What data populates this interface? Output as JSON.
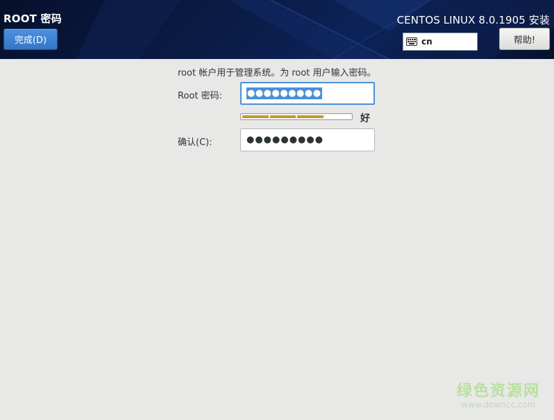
{
  "header": {
    "page_title": "ROOT 密码",
    "done_label": "完成(D)",
    "product_title": "CENTOS LINUX 8.0.1905 安装",
    "keyboard_layout": "cn",
    "help_label": "帮助!"
  },
  "form": {
    "description": "root 帐户用于管理系统。为 root 用户输入密码。",
    "root_password_label": "Root 密码:",
    "root_password_value": "●●●●●●●●●",
    "strength_label": "好",
    "strength_level": 0.75,
    "confirm_label": "确认(C):",
    "confirm_password_value": "●●●●●●●●●"
  },
  "watermark": {
    "text": "绿色资源网",
    "url": "www.downcc.com"
  },
  "colors": {
    "header_bg": "#0a1b45",
    "accent_blue": "#4a90d9",
    "strength_fill": "#c7982e",
    "window_bg": "#e8e8e7"
  },
  "icons": {
    "keyboard": "keyboard-icon"
  }
}
